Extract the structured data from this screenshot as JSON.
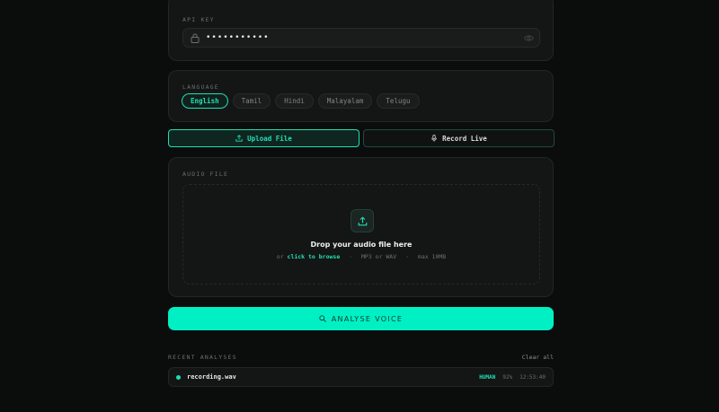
{
  "api_key": {
    "label": "API KEY",
    "value": "•••••••••••",
    "icons": {
      "lock": "lock-icon",
      "toggle": "eye-icon"
    }
  },
  "language": {
    "label": "LANGUAGE",
    "options": [
      "English",
      "Tamil",
      "Hindi",
      "Malayalam",
      "Telugu"
    ],
    "selected": "English"
  },
  "mode": {
    "upload_label": "Upload File",
    "record_label": "Record Live",
    "selected": "upload"
  },
  "audio": {
    "label": "AUDIO FILE",
    "drop_title": "Drop your audio file here",
    "or_text": "or",
    "browse_text": "click to browse",
    "formats": "MP3 or WAV",
    "max_size": "max 10MB"
  },
  "analyse": {
    "label": "ANALYSE VOICE"
  },
  "recent": {
    "label": "RECENT ANALYSES",
    "clear_label": "Clear all",
    "items": [
      {
        "file": "recording.wav",
        "verdict": "HUMAN",
        "confidence": "92%",
        "time": "12:53:40"
      }
    ]
  },
  "colors": {
    "accent": "#1fe0b4",
    "button": "#00f0c4",
    "background": "#0b0c0c"
  }
}
